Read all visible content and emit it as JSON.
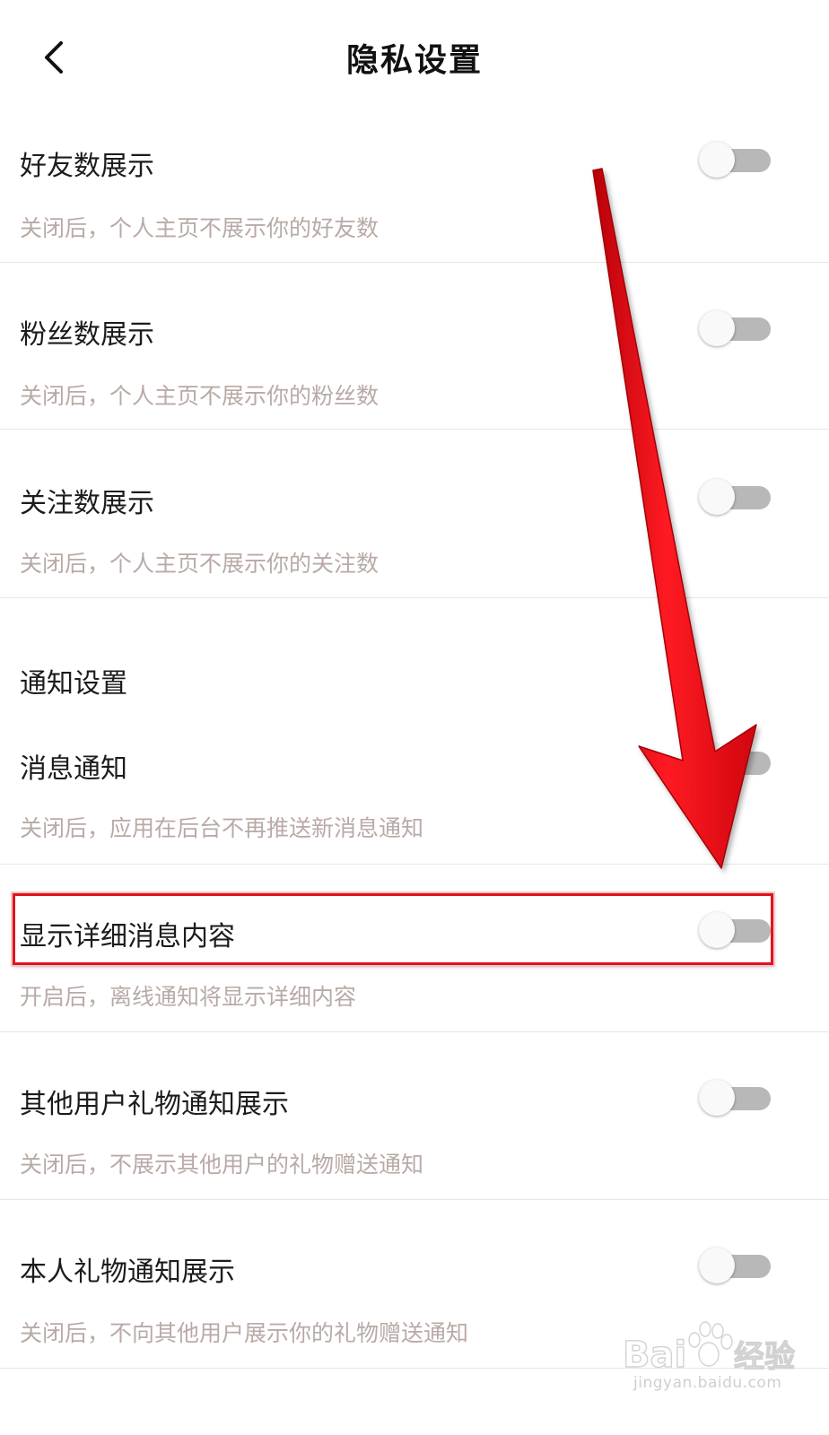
{
  "header": {
    "title": "隐私设置",
    "back_icon": "chevron-left-icon"
  },
  "settings": [
    {
      "title": "好友数展示",
      "desc": "关闭后，个人主页不展示你的好友数",
      "enabled": false
    },
    {
      "title": "粉丝数展示",
      "desc": "关闭后，个人主页不展示你的粉丝数",
      "enabled": false
    },
    {
      "title": "关注数展示",
      "desc": "关闭后，个人主页不展示你的关注数",
      "enabled": false
    }
  ],
  "notify_section": {
    "title": "通知设置",
    "items": [
      {
        "title": "消息通知",
        "desc": "关闭后，应用在后台不再推送新消息通知",
        "enabled": false
      },
      {
        "title": "显示详细消息内容",
        "desc": "开启后，离线通知将显示详细内容",
        "enabled": false,
        "highlighted": true
      },
      {
        "title": "其他用户礼物通知展示",
        "desc": "关闭后，不展示其他用户的礼物赠送通知",
        "enabled": false
      },
      {
        "title": "本人礼物通知展示",
        "desc": "关闭后，不向其他用户展示你的礼物赠送通知",
        "enabled": false
      }
    ]
  },
  "annotation": {
    "arrow_color": "#e8141c",
    "highlight_color": "#e0141c"
  },
  "watermark": {
    "logo_text": "Bai经验",
    "domain": "jingyan.baidu.com"
  }
}
